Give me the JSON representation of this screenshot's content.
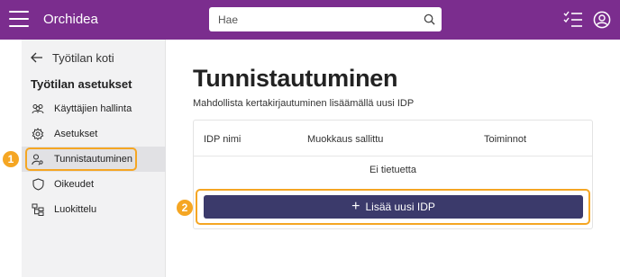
{
  "app": {
    "title": "Orchidea"
  },
  "search": {
    "placeholder": "Hae",
    "value": ""
  },
  "sidebar": {
    "back_label": "Työtilan koti",
    "heading": "Työtilan asetukset",
    "items": [
      {
        "label": "Käyttäjien hallinta",
        "icon": "users-icon",
        "active": false
      },
      {
        "label": "Asetukset",
        "icon": "gear-icon",
        "active": false
      },
      {
        "label": "Tunnistautuminen",
        "icon": "user-key-icon",
        "active": true
      },
      {
        "label": "Oikeudet",
        "icon": "shield-icon",
        "active": false
      },
      {
        "label": "Luokittelu",
        "icon": "hierarchy-icon",
        "active": false
      }
    ]
  },
  "main": {
    "title": "Tunnistautuminen",
    "description": "Mahdollista kertakirjautuminen lisäämällä uusi IDP",
    "table": {
      "columns": [
        "IDP nimi",
        "Muokkaus sallittu",
        "Toiminnot"
      ],
      "empty_text": "Ei tietuetta"
    },
    "add_button_label": "Lisää uusi IDP"
  },
  "annotations": [
    "1",
    "2"
  ],
  "colors": {
    "topbar": "#7b2d8e",
    "button": "#3b3a6b",
    "callout": "#f5a623"
  }
}
